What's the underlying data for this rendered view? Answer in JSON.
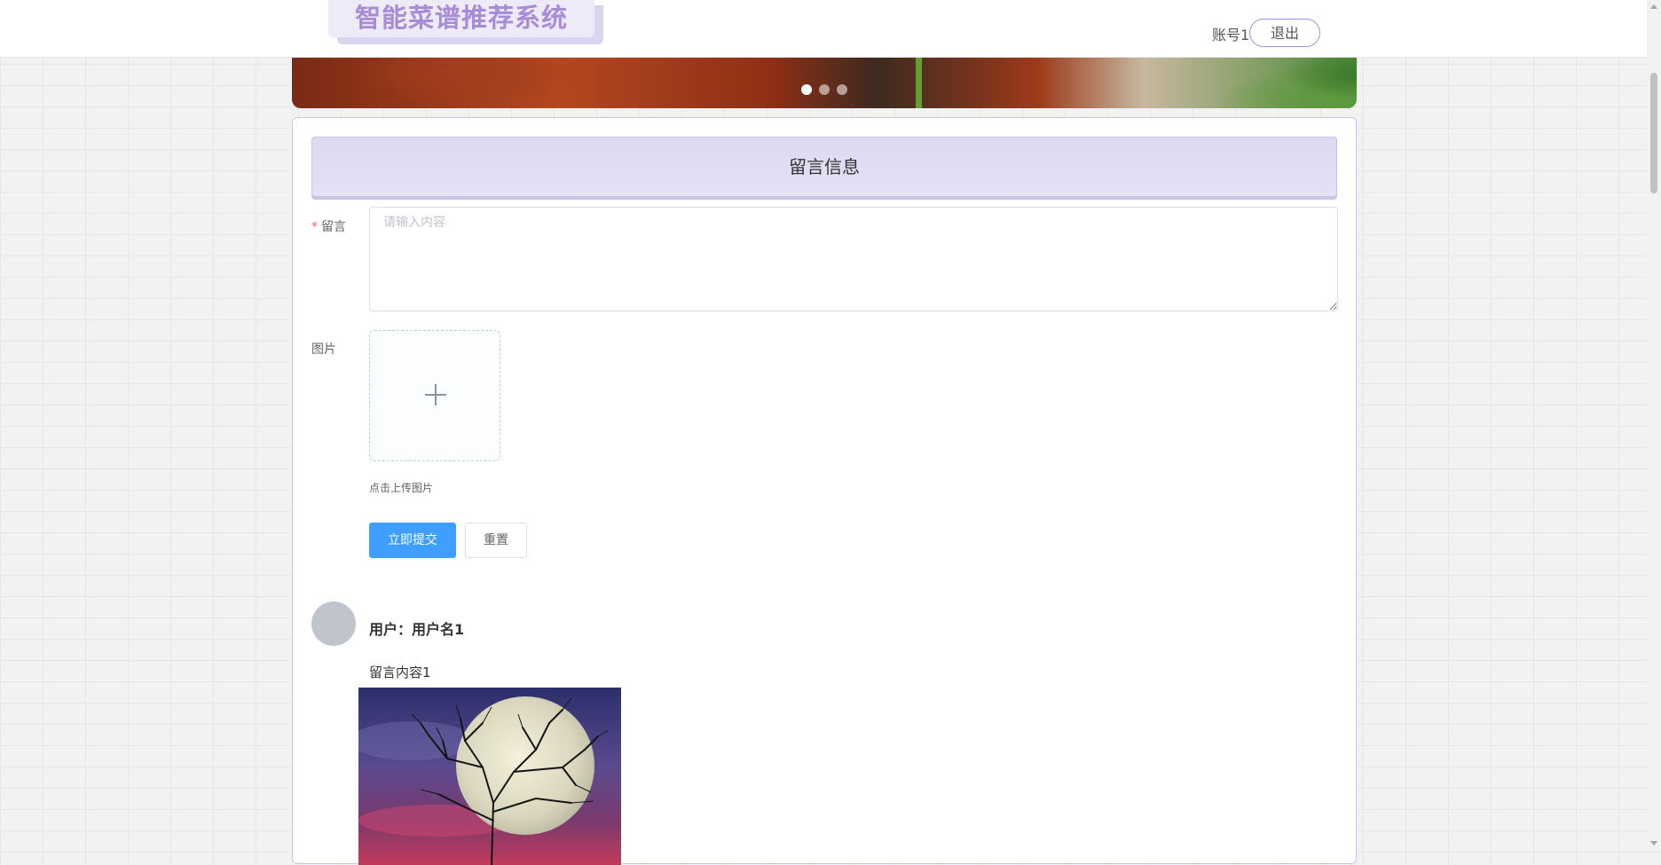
{
  "header": {
    "logo_text": "智能菜谱推荐系统",
    "account": "账号1",
    "logout_label": "退出"
  },
  "banner": {
    "slide_count": 3,
    "active_slide": 1
  },
  "form": {
    "title": "留言信息",
    "message_label": "留言",
    "required_mark": "*",
    "message_placeholder": "请输入内容",
    "image_label": "图片",
    "upload_tip": "点击上传图片",
    "submit_label": "立即提交",
    "reset_label": "重置"
  },
  "comments": [
    {
      "user": "用户：用户名1",
      "content": "留言内容1",
      "image_icon": "moon-tree-photo"
    }
  ],
  "colors": {
    "brand": "#a98cd8",
    "primary_button": "#409eff",
    "required": "#f56c6c"
  }
}
